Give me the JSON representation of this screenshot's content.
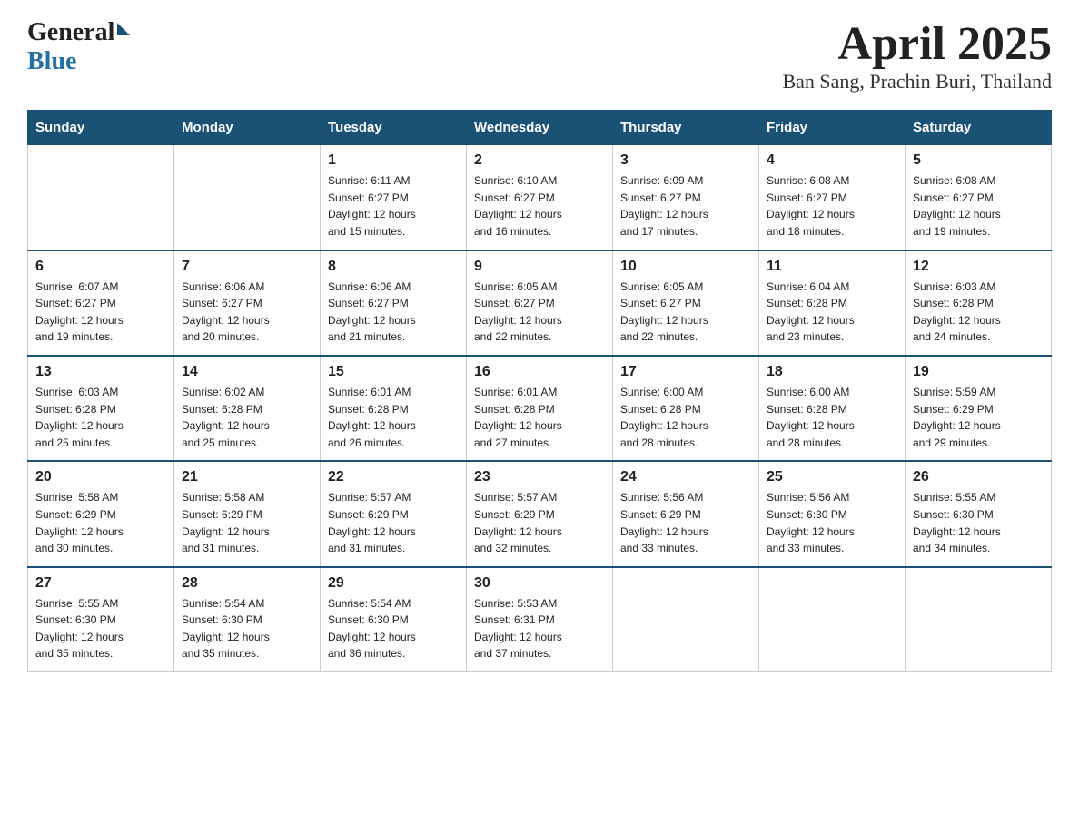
{
  "logo": {
    "text_general": "General",
    "text_blue": "Blue"
  },
  "title": {
    "month_year": "April 2025",
    "location": "Ban Sang, Prachin Buri, Thailand"
  },
  "calendar": {
    "headers": [
      "Sunday",
      "Monday",
      "Tuesday",
      "Wednesday",
      "Thursday",
      "Friday",
      "Saturday"
    ],
    "weeks": [
      [
        {
          "day": "",
          "info": ""
        },
        {
          "day": "",
          "info": ""
        },
        {
          "day": "1",
          "info": "Sunrise: 6:11 AM\nSunset: 6:27 PM\nDaylight: 12 hours\nand 15 minutes."
        },
        {
          "day": "2",
          "info": "Sunrise: 6:10 AM\nSunset: 6:27 PM\nDaylight: 12 hours\nand 16 minutes."
        },
        {
          "day": "3",
          "info": "Sunrise: 6:09 AM\nSunset: 6:27 PM\nDaylight: 12 hours\nand 17 minutes."
        },
        {
          "day": "4",
          "info": "Sunrise: 6:08 AM\nSunset: 6:27 PM\nDaylight: 12 hours\nand 18 minutes."
        },
        {
          "day": "5",
          "info": "Sunrise: 6:08 AM\nSunset: 6:27 PM\nDaylight: 12 hours\nand 19 minutes."
        }
      ],
      [
        {
          "day": "6",
          "info": "Sunrise: 6:07 AM\nSunset: 6:27 PM\nDaylight: 12 hours\nand 19 minutes."
        },
        {
          "day": "7",
          "info": "Sunrise: 6:06 AM\nSunset: 6:27 PM\nDaylight: 12 hours\nand 20 minutes."
        },
        {
          "day": "8",
          "info": "Sunrise: 6:06 AM\nSunset: 6:27 PM\nDaylight: 12 hours\nand 21 minutes."
        },
        {
          "day": "9",
          "info": "Sunrise: 6:05 AM\nSunset: 6:27 PM\nDaylight: 12 hours\nand 22 minutes."
        },
        {
          "day": "10",
          "info": "Sunrise: 6:05 AM\nSunset: 6:27 PM\nDaylight: 12 hours\nand 22 minutes."
        },
        {
          "day": "11",
          "info": "Sunrise: 6:04 AM\nSunset: 6:28 PM\nDaylight: 12 hours\nand 23 minutes."
        },
        {
          "day": "12",
          "info": "Sunrise: 6:03 AM\nSunset: 6:28 PM\nDaylight: 12 hours\nand 24 minutes."
        }
      ],
      [
        {
          "day": "13",
          "info": "Sunrise: 6:03 AM\nSunset: 6:28 PM\nDaylight: 12 hours\nand 25 minutes."
        },
        {
          "day": "14",
          "info": "Sunrise: 6:02 AM\nSunset: 6:28 PM\nDaylight: 12 hours\nand 25 minutes."
        },
        {
          "day": "15",
          "info": "Sunrise: 6:01 AM\nSunset: 6:28 PM\nDaylight: 12 hours\nand 26 minutes."
        },
        {
          "day": "16",
          "info": "Sunrise: 6:01 AM\nSunset: 6:28 PM\nDaylight: 12 hours\nand 27 minutes."
        },
        {
          "day": "17",
          "info": "Sunrise: 6:00 AM\nSunset: 6:28 PM\nDaylight: 12 hours\nand 28 minutes."
        },
        {
          "day": "18",
          "info": "Sunrise: 6:00 AM\nSunset: 6:28 PM\nDaylight: 12 hours\nand 28 minutes."
        },
        {
          "day": "19",
          "info": "Sunrise: 5:59 AM\nSunset: 6:29 PM\nDaylight: 12 hours\nand 29 minutes."
        }
      ],
      [
        {
          "day": "20",
          "info": "Sunrise: 5:58 AM\nSunset: 6:29 PM\nDaylight: 12 hours\nand 30 minutes."
        },
        {
          "day": "21",
          "info": "Sunrise: 5:58 AM\nSunset: 6:29 PM\nDaylight: 12 hours\nand 31 minutes."
        },
        {
          "day": "22",
          "info": "Sunrise: 5:57 AM\nSunset: 6:29 PM\nDaylight: 12 hours\nand 31 minutes."
        },
        {
          "day": "23",
          "info": "Sunrise: 5:57 AM\nSunset: 6:29 PM\nDaylight: 12 hours\nand 32 minutes."
        },
        {
          "day": "24",
          "info": "Sunrise: 5:56 AM\nSunset: 6:29 PM\nDaylight: 12 hours\nand 33 minutes."
        },
        {
          "day": "25",
          "info": "Sunrise: 5:56 AM\nSunset: 6:30 PM\nDaylight: 12 hours\nand 33 minutes."
        },
        {
          "day": "26",
          "info": "Sunrise: 5:55 AM\nSunset: 6:30 PM\nDaylight: 12 hours\nand 34 minutes."
        }
      ],
      [
        {
          "day": "27",
          "info": "Sunrise: 5:55 AM\nSunset: 6:30 PM\nDaylight: 12 hours\nand 35 minutes."
        },
        {
          "day": "28",
          "info": "Sunrise: 5:54 AM\nSunset: 6:30 PM\nDaylight: 12 hours\nand 35 minutes."
        },
        {
          "day": "29",
          "info": "Sunrise: 5:54 AM\nSunset: 6:30 PM\nDaylight: 12 hours\nand 36 minutes."
        },
        {
          "day": "30",
          "info": "Sunrise: 5:53 AM\nSunset: 6:31 PM\nDaylight: 12 hours\nand 37 minutes."
        },
        {
          "day": "",
          "info": ""
        },
        {
          "day": "",
          "info": ""
        },
        {
          "day": "",
          "info": ""
        }
      ]
    ]
  }
}
